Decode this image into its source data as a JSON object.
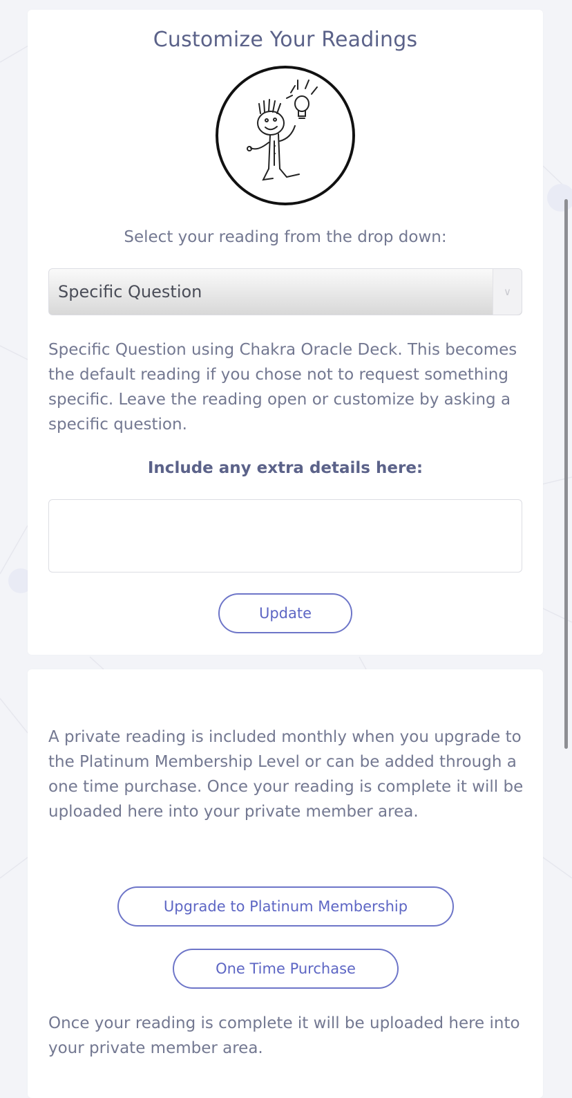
{
  "reading": {
    "title": "Customize Your Readings",
    "prompt": "Select your reading from the drop down:",
    "select_value": "Specific Question",
    "description": "Specific Question using Chakra Oracle Deck. This becomes the default reading if you chose not to request something specific. Leave the reading open or customize by asking a specific question.",
    "details_label": "Include any extra details here:",
    "details_value": "",
    "update_label": "Update"
  },
  "purchase": {
    "info": "A private reading is included monthly when you upgrade to the Platinum Membership Level or can be added through a one time purchase. Once your reading is complete it will be uploaded here into your private member area.",
    "upgrade_label": "Upgrade to Platinum Membership",
    "one_time_label": "One Time Purchase",
    "note": "Once your reading is complete it will be uploaded here into your private member area."
  },
  "colors": {
    "accent": "#6d75c8",
    "heading": "#5b6289",
    "text": "#737891",
    "background": "#f3f4f8"
  },
  "icons": {
    "avatar": "idea-character-illustration",
    "select": "chevron-down-icon"
  }
}
